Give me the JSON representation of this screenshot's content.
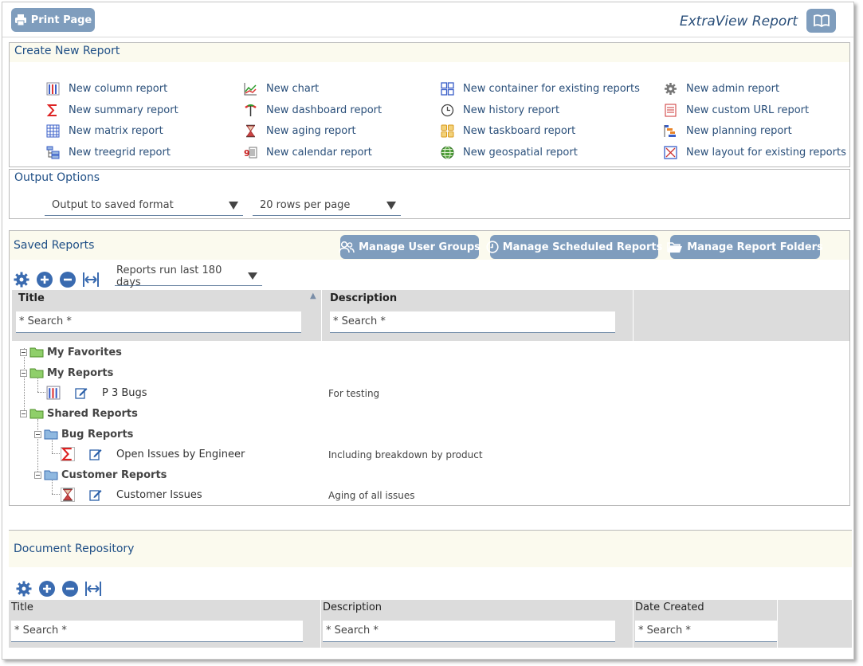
{
  "header": {
    "print_button": "Print Page",
    "app_title": "ExtraView Report"
  },
  "create_report": {
    "title": "Create New Report",
    "columns": [
      [
        {
          "label": "New column report",
          "icon": "column-report-icon"
        },
        {
          "label": "New summary report",
          "icon": "summary-report-icon"
        },
        {
          "label": "New matrix report",
          "icon": "matrix-report-icon"
        },
        {
          "label": "New treegrid report",
          "icon": "treegrid-report-icon"
        }
      ],
      [
        {
          "label": "New chart",
          "icon": "chart-icon"
        },
        {
          "label": "New dashboard report",
          "icon": "dashboard-report-icon"
        },
        {
          "label": "New aging report",
          "icon": "aging-report-icon"
        },
        {
          "label": "New calendar report",
          "icon": "calendar-report-icon"
        }
      ],
      [
        {
          "label": "New container for existing reports",
          "icon": "container-report-icon"
        },
        {
          "label": "New history report",
          "icon": "history-report-icon"
        },
        {
          "label": "New taskboard report",
          "icon": "taskboard-report-icon"
        },
        {
          "label": "New geospatial report",
          "icon": "geospatial-report-icon"
        }
      ],
      [
        {
          "label": "New admin report",
          "icon": "admin-report-icon"
        },
        {
          "label": "New custom URL report",
          "icon": "custom-url-report-icon"
        },
        {
          "label": "New planning report",
          "icon": "planning-report-icon"
        },
        {
          "label": "New layout for existing reports",
          "icon": "layout-report-icon"
        }
      ]
    ]
  },
  "output_options": {
    "title": "Output Options",
    "format_select": "Output to saved format",
    "rows_select": "20 rows per page"
  },
  "saved_reports": {
    "title": "Saved Reports",
    "buttons": {
      "user_groups": "Manage User Groups",
      "scheduled": "Manage Scheduled Reports",
      "folders": "Manage Report Folders"
    },
    "filter_select": "Reports run last 180 days",
    "columns": {
      "title": "Title",
      "description": "Description"
    },
    "search_placeholder": "* Search *",
    "tree": [
      {
        "label": "My Favorites",
        "type": "folder",
        "description": ""
      },
      {
        "label": "My Reports",
        "type": "folder",
        "description": ""
      },
      {
        "label": "P 3 Bugs",
        "type": "report",
        "report_icon": "column-report-icon",
        "description": "For testing"
      },
      {
        "label": "Shared Reports",
        "type": "folder",
        "description": ""
      },
      {
        "label": "Bug Reports",
        "type": "subfolder",
        "description": ""
      },
      {
        "label": "Open Issues by Engineer",
        "type": "report",
        "report_icon": "summary-report-icon",
        "description": "Including breakdown by product"
      },
      {
        "label": "Customer Reports",
        "type": "subfolder",
        "description": ""
      },
      {
        "label": "Customer Issues",
        "type": "report",
        "report_icon": "aging-report-icon",
        "description": "Aging of all issues"
      }
    ]
  },
  "document_repository": {
    "title": "Document Repository",
    "columns": {
      "title": "Title",
      "description": "Description",
      "date_created": "Date Created"
    },
    "search_placeholder": "* Search *"
  }
}
